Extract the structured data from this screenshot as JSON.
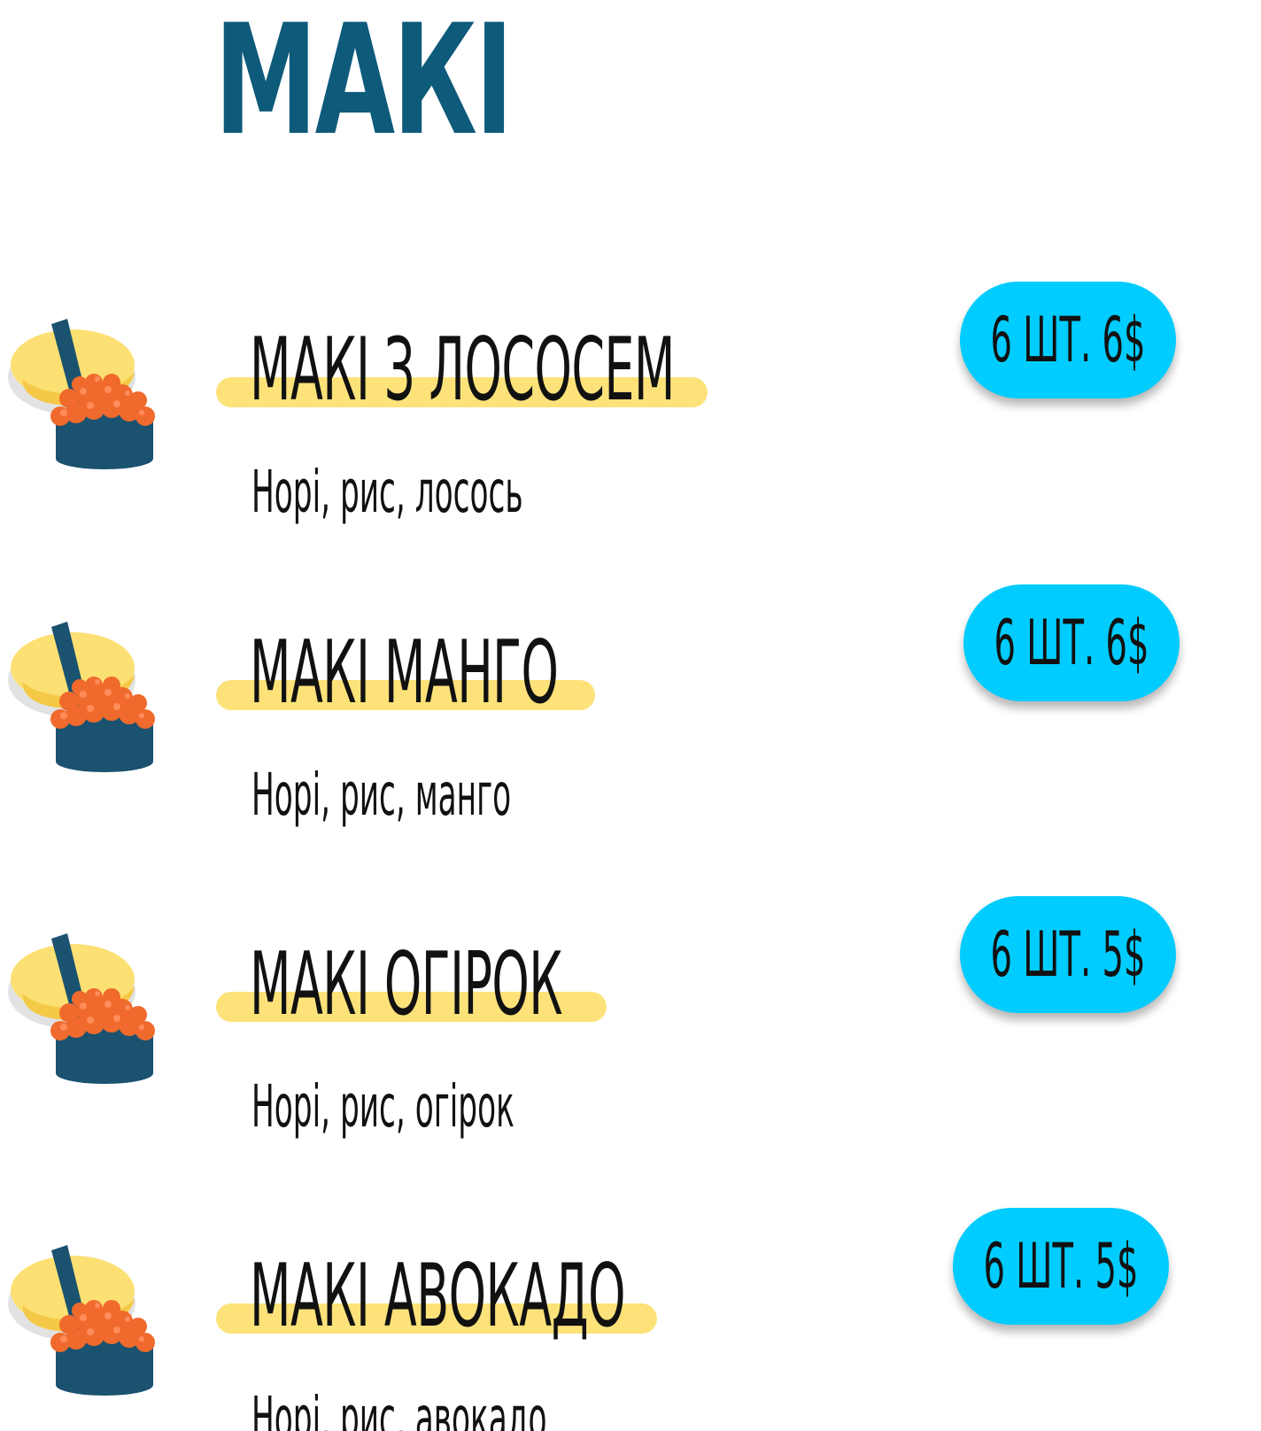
{
  "page": {
    "title": "МАКІ"
  },
  "items": [
    {
      "name": "МАКІ З ЛОСОСЕМ",
      "description": "Норі, рис, лосось",
      "price": "6 ШТ. 6$"
    },
    {
      "name": "МАКІ МАНГО",
      "description": "Норі, рис, манго",
      "price": "6 ШТ. 6$"
    },
    {
      "name": "МАКІ ОГІРОК",
      "description": "Норі, рис, огірок",
      "price": "6 ШТ. 5$"
    },
    {
      "name": "МАКІ АВОКАДО",
      "description": "Норі, рис, авокадо",
      "price": "6 ШТ. 5$"
    }
  ],
  "colors": {
    "title": "#0e5a7a",
    "highlight": "#fde27a",
    "price_badge": "#00ccff",
    "text": "#111111"
  },
  "icons": {
    "item_icon": "sushi-icon"
  }
}
